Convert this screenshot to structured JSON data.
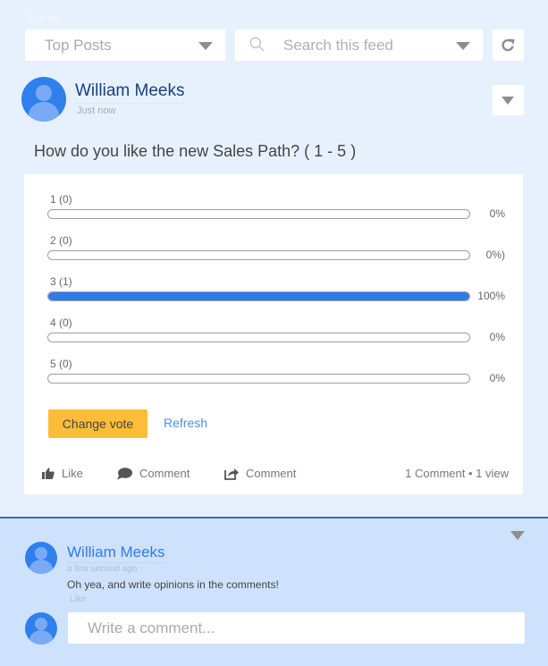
{
  "toolbar": {
    "sort_label": "Sort by",
    "sort_value": "Top Posts",
    "search_placeholder": "Search this feed"
  },
  "post": {
    "author": "William Meeks",
    "timestamp": "Just now",
    "question": "How do you like the new Sales Path? ( 1 - 5 )",
    "accent_color": "#2f7be8",
    "options": [
      {
        "label": "1 (0)",
        "percent_text": "0%",
        "fraction": 0
      },
      {
        "label": "2 (0)",
        "percent_text": "0%)",
        "fraction": 0
      },
      {
        "label": "3 (1)",
        "percent_text": "100%",
        "fraction": 1
      },
      {
        "label": "4 (0)",
        "percent_text": "0%",
        "fraction": 0
      },
      {
        "label": "5 (0)",
        "percent_text": "0%",
        "fraction": 0
      }
    ],
    "change_vote_label": "Change vote",
    "refresh_label": "Refresh",
    "actions": {
      "like": "Like",
      "comment": "Comment",
      "share": "Comment"
    },
    "stats": "1 Comment  •  1 view"
  },
  "comment": {
    "author": "William Meeks",
    "timestamp": "a few second ago",
    "text": "Oh yea, and write opinions in the comments!",
    "like_label": "Like",
    "input_placeholder": "Write a comment..."
  }
}
